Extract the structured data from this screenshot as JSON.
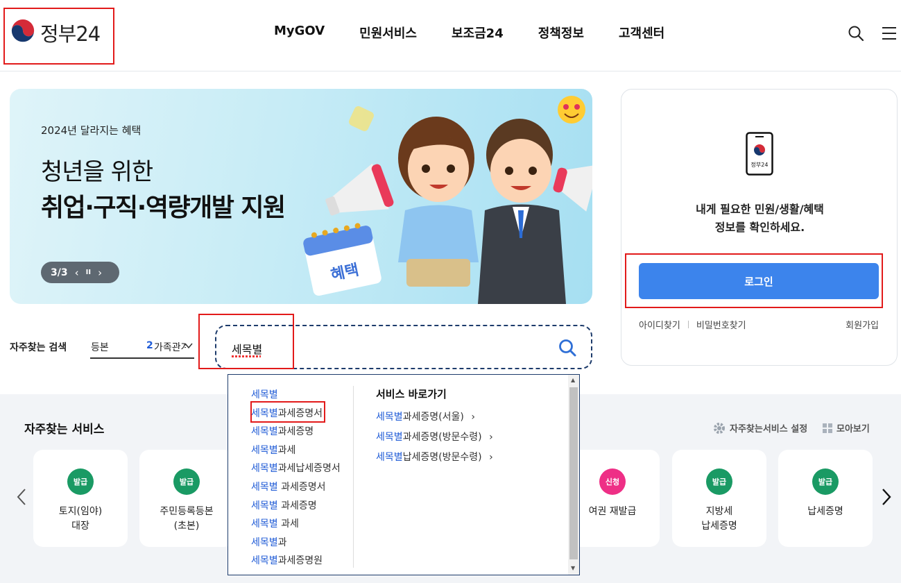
{
  "header": {
    "logo_text": "정부24",
    "nav": [
      "MyGOV",
      "민원서비스",
      "보조금24",
      "정책정보",
      "고객센터"
    ],
    "icons": [
      "search-icon",
      "menu-icon"
    ]
  },
  "banner": {
    "subtitle": "2024년 달라지는 혜택",
    "title_line1": "청년을 위한",
    "title_line2": "취업·구직·역량개발 지원",
    "pager": "3/3",
    "prev": "‹",
    "pause": "II",
    "next": "›",
    "calendar_label": "혜택"
  },
  "login": {
    "phone_label": "정부24",
    "message_line1": "내게 필요한 민원/생활/혜택",
    "message_line2": "정보를 확인하세요.",
    "login_button": "로그인",
    "find_id": "아이디찾기",
    "find_pw": "비밀번호찾기",
    "join": "회원가입"
  },
  "search": {
    "label": "자주찾는 검색",
    "keyword1": "등본",
    "keyword2_num": "2",
    "keyword2": "가족관계",
    "input_value": "세목별"
  },
  "autocomplete": {
    "highlight": "세목별",
    "suggestions": [
      {
        "hl": "세목별",
        "rest": ""
      },
      {
        "hl": "세목별",
        "rest": "과세증명서"
      },
      {
        "hl": "세목별",
        "rest": "과세증명"
      },
      {
        "hl": "세목별",
        "rest": "과세"
      },
      {
        "hl": "세목별",
        "rest": "과세납세증명서"
      },
      {
        "hl": "세목별",
        "rest": " 과세증명서"
      },
      {
        "hl": "세목별",
        "rest": " 과세증명"
      },
      {
        "hl": "세목별",
        "rest": " 과세"
      },
      {
        "hl": "세목별",
        "rest": "과"
      },
      {
        "hl": "세목별",
        "rest": "과세증명원"
      }
    ],
    "shortcut_title": "서비스 바로가기",
    "shortcuts": [
      {
        "hl": "세목별",
        "rest": "과세증명(서울)",
        "arrow": "›"
      },
      {
        "hl": "세목별",
        "rest": "과세증명(방문수령)",
        "arrow": "›"
      },
      {
        "hl": "세목별",
        "rest": "납세증명(방문수령)",
        "arrow": "›"
      }
    ]
  },
  "services": {
    "title": "자주찾는 서비스",
    "settings": "자주찾는서비스 설정",
    "view_all": "모아보기",
    "colors": {
      "issue": "#1a9a64",
      "apply": "#ee2f86"
    },
    "cards": [
      {
        "badge": "발급",
        "type": "issue",
        "name_line1": "토지(임야)",
        "name_line2": "대장"
      },
      {
        "badge": "발급",
        "type": "issue",
        "name_line1": "주민등록등본",
        "name_line2": "(초본)"
      },
      {
        "badge": "신청",
        "type": "apply",
        "name_line1": "여권 재발급",
        "name_line2": ""
      },
      {
        "badge": "발급",
        "type": "issue",
        "name_line1": "지방세",
        "name_line2": "납세증명"
      },
      {
        "badge": "발급",
        "type": "issue",
        "name_line1": "납세증명",
        "name_line2": ""
      }
    ]
  }
}
